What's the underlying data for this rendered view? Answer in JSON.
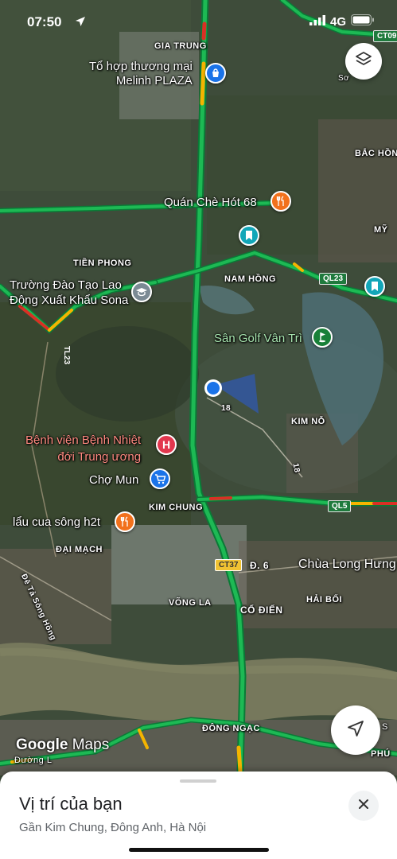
{
  "status_bar": {
    "time": "07:50",
    "network": "4G",
    "icons": [
      "location-arrow-icon",
      "signal-icon",
      "battery-icon"
    ]
  },
  "map": {
    "style": "satellite",
    "area_labels": {
      "gia_trung": "GIA TRUNG",
      "tien_phong": "TIỀN PHONG",
      "nam_hong": "NAM HỒNG",
      "kim_no": "KIM NỖ",
      "kim_chung": "KIM CHUNG",
      "dai_mach": "ĐẠI MẠCH",
      "vong_la": "VÕNG LA",
      "co_dien": "CỔ ĐIỂN",
      "hai_boi": "HẢI BỐI",
      "dong_ngac": "ĐÔNG NGẠC",
      "bac_hong": "BẮC HỒNG",
      "my": "MỸ",
      "phu": "PHÚ",
      "road_d6": "Đ. 6",
      "road_18a": "18",
      "road_18b": "18",
      "dyke": "Đê Tả Sông Hồng",
      "edge_so": "Sơ",
      "edge_duong": "Đường L",
      "edge_s": "S"
    },
    "shields": {
      "ct09": "CT09",
      "ql23": "QL23",
      "tl23": "TL23",
      "ql5": "QL5",
      "ct37": "CT37"
    },
    "pois": {
      "melinh": {
        "line1": "Tổ hợp thương mại",
        "line2": "Melinh PLAZA",
        "icon": "shopping-bag-icon"
      },
      "quan_che": {
        "name": "Quán Chè Hót 68",
        "icon": "restaurant-icon"
      },
      "truong_lao_dong": {
        "line1": "Trường Đào Tạo Lao",
        "line2": "Động Xuất Khẩu Sona",
        "icon": "school-icon"
      },
      "san_golf": {
        "name": "Sân Golf Vân Trì",
        "icon": "golf-icon"
      },
      "benh_vien": {
        "line1": "Bệnh viện Bệnh Nhiệt",
        "line2": "đới Trung ương",
        "icon": "hospital-icon"
      },
      "cho_mun": {
        "name": "Chợ Mun",
        "icon": "shopping-cart-icon"
      },
      "lau_cua": {
        "name": "lẩu cua sông h2t",
        "icon": "restaurant-icon"
      },
      "chua_long_hung": {
        "name": "Chùa Long Hưng"
      }
    },
    "colors": {
      "traffic_green": "#1db954",
      "traffic_yellow": "#f4b400",
      "traffic_red": "#d93025",
      "location_dot": "#1a73e8",
      "pin_red_orange": "#f2711c",
      "pin_teal": "#12a6b8",
      "pin_blue": "#1a73e8",
      "pin_gray": "#7b8a94",
      "pin_hospital": "#e2374e",
      "pin_golf": "#188038"
    }
  },
  "controls": {
    "layers_icon": "layers-icon",
    "recenter_icon": "navigation-arrow-icon"
  },
  "branding": {
    "google": "Google",
    "maps": "Maps"
  },
  "bottom_sheet": {
    "title": "Vị trí của bạn",
    "subtitle": "Gần Kim Chung, Đông Anh, Hà Nội",
    "close_icon": "close-icon"
  }
}
